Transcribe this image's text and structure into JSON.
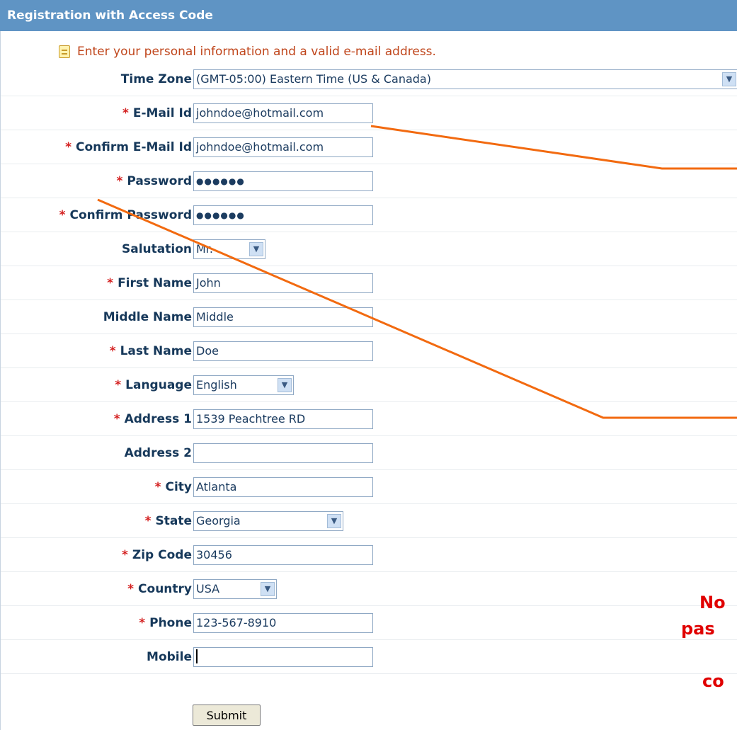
{
  "header": {
    "title": "Registration with Access Code"
  },
  "instruction": {
    "text": "Enter your personal information and a valid e-mail address."
  },
  "rows": [
    {
      "label": "Time Zone",
      "required": false,
      "value": "(GMT-05:00) Eastern Time (US & Canada)",
      "type": "select"
    },
    {
      "label": "E-Mail Id",
      "required": true,
      "value": "johndoe@hotmail.com",
      "type": "text"
    },
    {
      "label": "Confirm E-Mail Id",
      "required": true,
      "value": "johndoe@hotmail.com",
      "type": "text"
    },
    {
      "label": "Password",
      "required": true,
      "value": "●●●●●●",
      "type": "password"
    },
    {
      "label": "Confirm Password",
      "required": true,
      "value": "●●●●●●",
      "type": "password"
    },
    {
      "label": "Salutation",
      "required": false,
      "value": "Mr.",
      "type": "select"
    },
    {
      "label": "First Name",
      "required": true,
      "value": "John",
      "type": "text"
    },
    {
      "label": "Middle Name",
      "required": false,
      "value": "Middle",
      "type": "text"
    },
    {
      "label": "Last Name",
      "required": true,
      "value": "Doe",
      "type": "text"
    },
    {
      "label": "Language",
      "required": true,
      "value": "English",
      "type": "select"
    },
    {
      "label": "Address 1",
      "required": true,
      "value": "1539 Peachtree RD",
      "type": "text"
    },
    {
      "label": "Address 2",
      "required": false,
      "value": "",
      "type": "text"
    },
    {
      "label": "City",
      "required": true,
      "value": "Atlanta",
      "type": "text"
    },
    {
      "label": "State",
      "required": true,
      "value": "Georgia",
      "type": "select"
    },
    {
      "label": "Zip Code",
      "required": true,
      "value": "30456",
      "type": "text"
    },
    {
      "label": "Country",
      "required": true,
      "value": "USA",
      "type": "select"
    },
    {
      "label": "Phone",
      "required": true,
      "value": "123-567-8910",
      "type": "text"
    },
    {
      "label": "Mobile",
      "required": false,
      "value": "",
      "type": "text"
    }
  ],
  "submit": {
    "label": "Submit"
  },
  "required_marker": "*",
  "callout": {
    "lines": [
      "No",
      "pas",
      "",
      "co"
    ]
  },
  "colors": {
    "header_bg": "#5f94c4",
    "required": "#d42020",
    "callout": "#e00000",
    "annotation_line": "#f26a10"
  },
  "icons": {
    "instruction": "note-icon",
    "dropdown": "chevron-down-icon"
  }
}
